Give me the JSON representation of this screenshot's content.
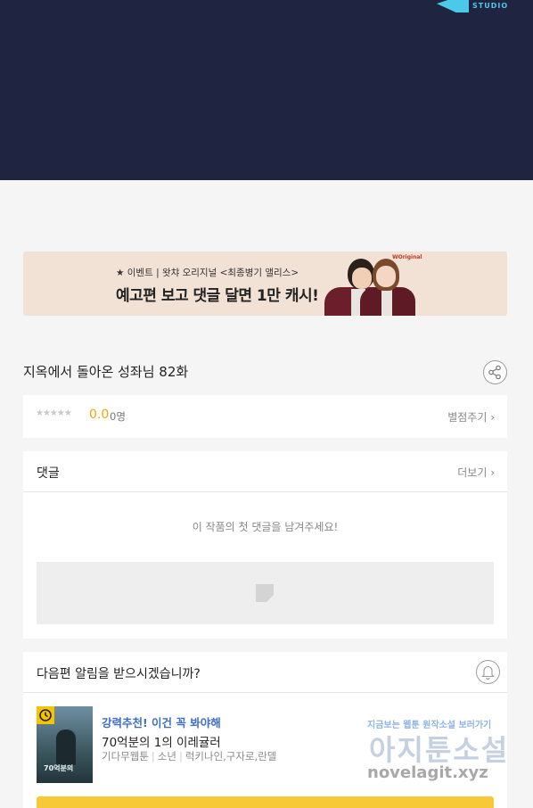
{
  "hero": {
    "logo_text": "STUDIO",
    "bg_color": "#1f2540",
    "accent": "#4cc9e8"
  },
  "banner": {
    "sub": "★ 이벤트 | 왓챠 오리지널 <최종병기 앨리스>",
    "main": "예고편 보고 댓글 달면 1만 캐시!",
    "badge": "WOriginal"
  },
  "episode": {
    "title": "지옥에서 돌아온 성좌님 82화"
  },
  "rating": {
    "stars": "★★★★★",
    "score": "0.0",
    "count": "0명",
    "rate_link": "별점주기 ›"
  },
  "comments": {
    "title": "댓글",
    "more": "더보기 ›",
    "empty": "이 작품의 첫 댓글을 남겨주세요!"
  },
  "next": {
    "question": "다음편 알림을 받으시겠습니까?",
    "promo": "강력추천! 이건 꼭 봐야해",
    "work_title": "70억분의 1의 이레귤러",
    "tags": [
      "기다무웹툰",
      "소년",
      "럭키나인,구자로,란델"
    ],
    "thumb_text": "70억분의"
  },
  "watermark": {
    "line1": "지금보는 웹툰 원작소설 보러가기",
    "line2": "아지툰소설",
    "line3": "novelagit.xyz"
  },
  "colors": {
    "score": "#f2a900",
    "promo": "#3d6fc4",
    "button": "#f8c936"
  }
}
